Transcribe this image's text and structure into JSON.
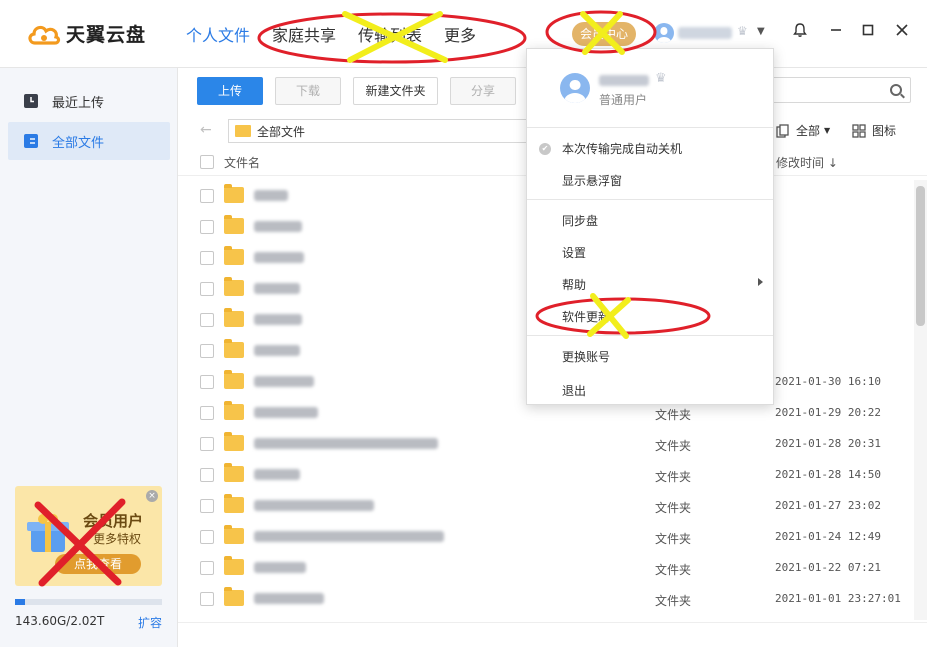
{
  "app": {
    "title": "天翼云盘"
  },
  "nav": {
    "items": [
      "个人文件",
      "家庭共享",
      "传输列表",
      "更多"
    ]
  },
  "header": {
    "vip_label": "会员中心"
  },
  "sidebar": {
    "items": [
      {
        "label": "最近上传"
      },
      {
        "label": "全部文件"
      }
    ],
    "promo": {
      "title": "会员用户",
      "subtitle": "更多特权",
      "button": "点我查看"
    },
    "storage": {
      "used_label": "143.60G/2.02T",
      "expand_label": "扩容",
      "used_fraction": 0.07
    }
  },
  "toolbar": {
    "upload": "上传",
    "download": "下载",
    "new_folder": "新建文件夹",
    "share": "分享"
  },
  "path": {
    "current": "全部文件",
    "view_filter": "全部",
    "view_mode": "图标"
  },
  "table": {
    "col_name": "文件名",
    "col_modified": "修改时间 ↓",
    "rows": [
      {
        "type": "",
        "date": ""
      },
      {
        "type": "",
        "date": ""
      },
      {
        "type": "",
        "date": ""
      },
      {
        "type": "",
        "date": ""
      },
      {
        "type": "",
        "date": ""
      },
      {
        "type": "",
        "date": ""
      },
      {
        "type": "",
        "date": "2021-01-30 16:10"
      },
      {
        "type": "文件夹",
        "date": "2021-01-29 20:22"
      },
      {
        "type": "文件夹",
        "date": "2021-01-28 20:31"
      },
      {
        "type": "文件夹",
        "date": "2021-01-28 14:50"
      },
      {
        "type": "文件夹",
        "date": "2021-01-27 23:02"
      },
      {
        "type": "文件夹",
        "date": "2021-01-24 12:49"
      },
      {
        "type": "文件夹",
        "date": "2021-01-22 07:21"
      },
      {
        "type": "文件夹",
        "date": "2021-01-01 23:27:01"
      }
    ]
  },
  "menu": {
    "user_type": "普通用户",
    "auto_shutdown": "本次传输完成自动关机",
    "floating_window": "显示悬浮窗",
    "sync_disk": "同步盘",
    "settings": "设置",
    "help": "帮助",
    "software_update": "软件更新",
    "switch_account": "更换账号",
    "logout": "退出"
  },
  "colors": {
    "accent": "#2b7be5",
    "annotation_red": "#e0202a",
    "annotation_yellow": "#f2ee1c"
  }
}
